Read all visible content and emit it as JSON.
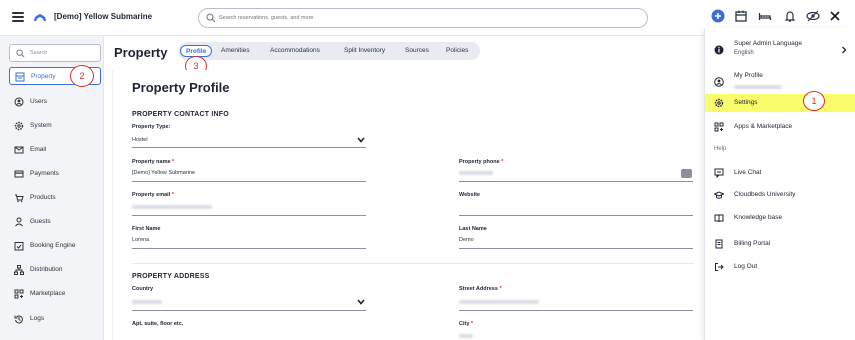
{
  "topbar": {
    "brand": "[Demo] Yellow Submarine",
    "search_placeholder": "Search reservations, guests, and more",
    "icons": [
      "add-icon",
      "calendar-icon",
      "bed-icon",
      "bell-icon",
      "view-icon",
      "close-icon"
    ]
  },
  "leftnav": {
    "search_placeholder": "Search",
    "items": [
      {
        "label": "Property",
        "icon": "property-icon",
        "active": true
      },
      {
        "label": "Users",
        "icon": "users-icon"
      },
      {
        "label": "System",
        "icon": "gear-icon"
      },
      {
        "label": "Email",
        "icon": "email-icon"
      },
      {
        "label": "Payments",
        "icon": "card-icon"
      },
      {
        "label": "Products",
        "icon": "cart-icon"
      },
      {
        "label": "Guests",
        "icon": "guest-icon"
      },
      {
        "label": "Booking Engine",
        "icon": "booking-icon"
      },
      {
        "label": "Distribution",
        "icon": "distribution-icon"
      },
      {
        "label": "Marketplace",
        "icon": "marketplace-icon"
      },
      {
        "label": "Logs",
        "icon": "logs-icon"
      }
    ]
  },
  "page": {
    "title": "Property",
    "tabs": [
      "Profile",
      "Amenities",
      "Accommodations",
      "Split Inventory",
      "Sources",
      "Policies"
    ]
  },
  "callouts": {
    "one": "1",
    "two": "2",
    "three": "3"
  },
  "profile": {
    "title": "Property Profile",
    "contact_section": "PROPERTY CONTACT INFO",
    "property_type_label": "Property Type:",
    "property_type_value": "Hostel",
    "property_name_label": "Property name",
    "property_name_value": "[Demo] Yellow Submarine",
    "property_phone_label": "Property phone",
    "property_email_label": "Property email",
    "website_label": "Website",
    "first_name_label": "First Name",
    "first_name_value": "Lorena",
    "last_name_label": "Last Name",
    "last_name_value": "Demo",
    "address_section": "PROPERTY ADDRESS",
    "country_label": "Country",
    "street_label": "Street Address",
    "apt_label": "Apt, suite, floor etc.",
    "city_label": "City",
    "required_mark": "*"
  },
  "menu": {
    "language_title": "Super Admin Language",
    "language_value": "English",
    "profile_label": "My Profile",
    "settings_label": "Settings",
    "apps_label": "Apps & Marketplace",
    "help_section": "Help",
    "live_chat": "Live Chat",
    "university": "Cloudbeds University",
    "knowledge": "Knowledge base",
    "billing": "Billing Portal",
    "logout": "Log Out"
  },
  "colors": {
    "accent": "#3a6fd8",
    "callout": "#d6312c",
    "highlight": "#fbfc6b"
  }
}
